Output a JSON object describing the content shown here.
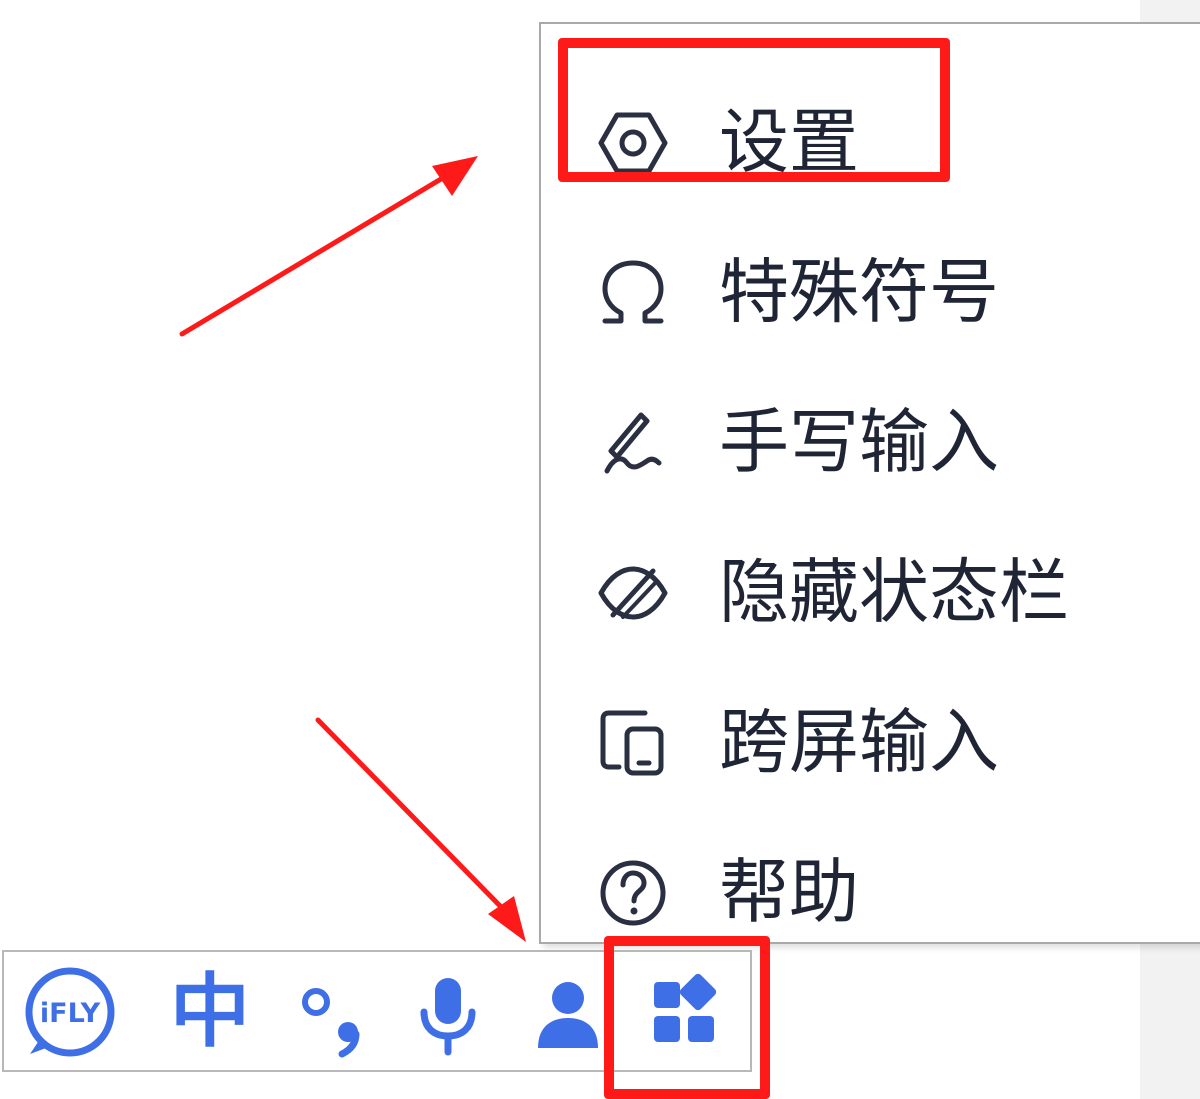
{
  "menu": {
    "items": [
      {
        "label": "设置",
        "icon": "settings-hexagon-icon"
      },
      {
        "label": "特殊符号",
        "icon": "omega-icon"
      },
      {
        "label": "手写输入",
        "icon": "handwriting-pen-icon"
      },
      {
        "label": "隐藏状态栏",
        "icon": "hide-eye-icon"
      },
      {
        "label": "跨屏输入",
        "icon": "cross-screen-icon"
      },
      {
        "label": "帮助",
        "icon": "help-circle-icon"
      }
    ]
  },
  "toolbar": {
    "logo_text": "iFLY",
    "mode_label": "中",
    "buttons": [
      "ifly-logo-icon",
      "chinese-mode",
      "punctuation-icon",
      "microphone-icon",
      "user-icon",
      "apps-grid-icon"
    ]
  },
  "colors": {
    "accent": "#3f6fe6",
    "highlight": "#ff1a1a",
    "menu_text": "#1f2535",
    "menu_icon": "#2a3042"
  }
}
